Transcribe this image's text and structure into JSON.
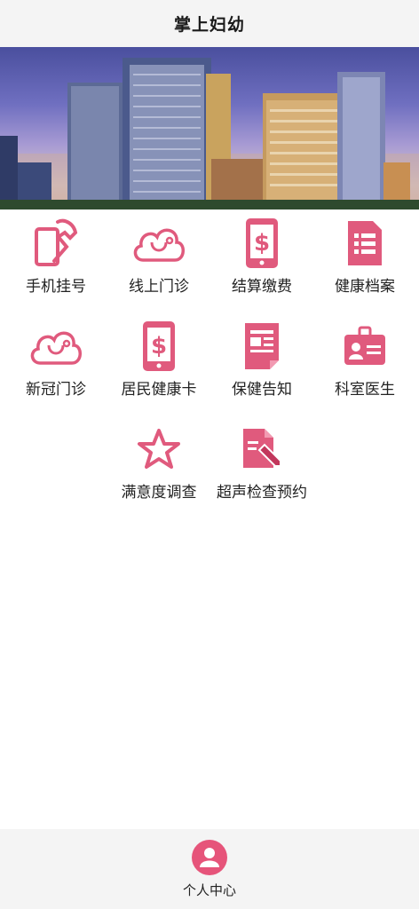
{
  "header": {
    "title": "掌上妇幼"
  },
  "banner": {
    "image_alt": "hospital-buildings"
  },
  "theme": {
    "accent": "#e05a7d"
  },
  "menu": [
    {
      "label": "手机挂号",
      "icon": "phone-register-icon"
    },
    {
      "label": "线上门诊",
      "icon": "cloud-stethoscope-icon"
    },
    {
      "label": "结算缴费",
      "icon": "mobile-dollar-icon"
    },
    {
      "label": "健康档案",
      "icon": "document-list-icon"
    },
    {
      "label": "新冠门诊",
      "icon": "cloud-stethoscope-icon"
    },
    {
      "label": "居民健康卡",
      "icon": "mobile-dollar-icon"
    },
    {
      "label": "保健告知",
      "icon": "newspaper-icon"
    },
    {
      "label": "科室医生",
      "icon": "id-card-icon"
    },
    {
      "label": "满意度调查",
      "icon": "star-icon"
    },
    {
      "label": "超声检查预约",
      "icon": "file-edit-icon"
    }
  ],
  "bottom_nav": {
    "label": "个人中心",
    "icon": "user-icon"
  }
}
